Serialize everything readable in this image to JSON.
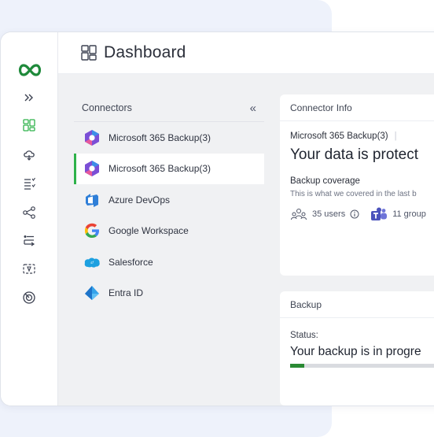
{
  "app": {
    "page_title": "Dashboard",
    "logo_icon": "infinity-logo-icon"
  },
  "rail": {
    "items": [
      {
        "icon": "expand-chevrons-icon"
      },
      {
        "icon": "dashboard-grid-icon",
        "active": true
      },
      {
        "icon": "cloud-backup-icon"
      },
      {
        "icon": "list-check-icon"
      },
      {
        "icon": "share-nodes-icon"
      },
      {
        "icon": "workflow-icon"
      },
      {
        "icon": "restore-icon"
      },
      {
        "icon": "radar-icon"
      }
    ]
  },
  "connectors": {
    "header": "Connectors",
    "collapse_glyph": "«",
    "items": [
      {
        "label": "Microsoft 365 Backup(3)",
        "icon": "microsoft-365-icon",
        "active": false
      },
      {
        "label": "Microsoft 365 Backup(3)",
        "icon": "microsoft-365-icon",
        "active": true
      },
      {
        "label": "Azure DevOps",
        "icon": "azure-devops-icon",
        "active": false
      },
      {
        "label": "Google Workspace",
        "icon": "google-icon",
        "active": false
      },
      {
        "label": "Salesforce",
        "icon": "salesforce-icon",
        "active": false
      },
      {
        "label": "Entra ID",
        "icon": "entra-id-icon",
        "active": false
      }
    ]
  },
  "connector_info": {
    "header": "Connector Info",
    "name": "Microsoft 365 Backup(3)",
    "headline": "Your data is protect",
    "coverage_title": "Backup coverage",
    "coverage_desc": "This is what we covered in the last b",
    "users": "35 users",
    "groups": "11 group"
  },
  "backup": {
    "header": "Backup",
    "status_label": "Status:",
    "message": "Your backup is in progre",
    "progress_fraction": 0.08
  },
  "colors": {
    "accent_green": "#2eb24a",
    "progress_fill": "#2a8a34",
    "content_bg": "#f0f1f3"
  }
}
